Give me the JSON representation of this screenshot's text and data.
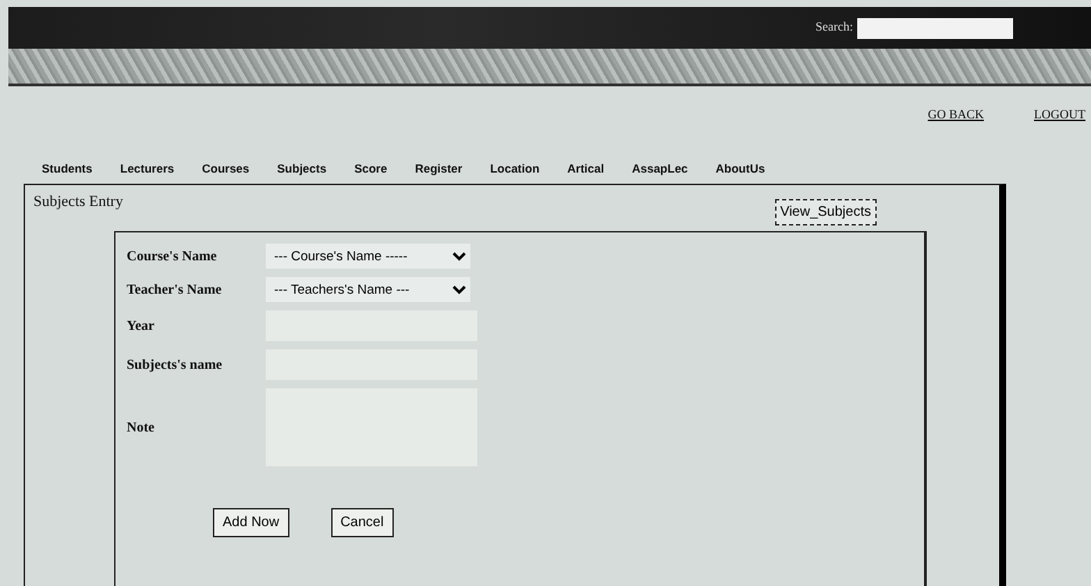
{
  "header": {
    "search": {
      "label": "Search:"
    }
  },
  "top_links": [
    "GO BACK",
    "LOGOUT"
  ],
  "nav": [
    "Students",
    "Lecturers",
    "Courses",
    "Subjects",
    "Score",
    "Register",
    "Location",
    "Artical",
    "AssapLec",
    "AboutUs"
  ],
  "panel": {
    "title": "Subjects Entry",
    "view_button": "View_Subjects",
    "fields": [
      {
        "kind": "select",
        "label": "Course's Name",
        "value": "--- Course's Name -----"
      },
      {
        "kind": "select",
        "label": "Teacher's Name",
        "value": "--- Teachers's Name ---"
      },
      {
        "kind": "text",
        "label": "Year"
      },
      {
        "kind": "text",
        "label": "Subjects's name"
      },
      {
        "kind": "textarea",
        "label": "Note"
      }
    ],
    "buttons": [
      "Add Now",
      "Cancel"
    ]
  }
}
